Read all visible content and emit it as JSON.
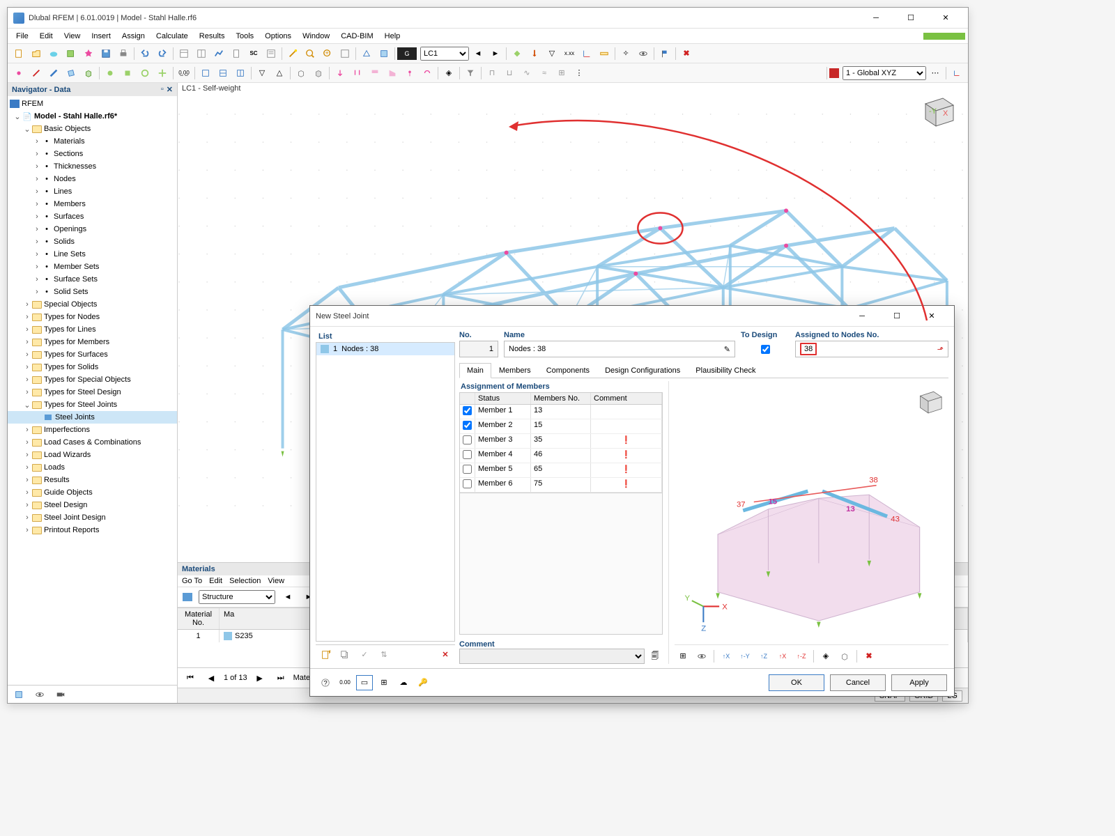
{
  "app": {
    "title": "Dlubal RFEM | 6.01.0019 | Model - Stahl Halle.rf6"
  },
  "menu": [
    "File",
    "Edit",
    "View",
    "Insert",
    "Assign",
    "Calculate",
    "Results",
    "Tools",
    "Options",
    "Window",
    "CAD-BIM",
    "Help"
  ],
  "toolbar2": {
    "lc_combo": "LC1",
    "coord_combo": "1 - Global XYZ"
  },
  "navigator": {
    "title": "Navigator - Data",
    "root": "RFEM",
    "model": "Model - Stahl Halle.rf6*",
    "basic_label": "Basic Objects",
    "basic": [
      "Materials",
      "Sections",
      "Thicknesses",
      "Nodes",
      "Lines",
      "Members",
      "Surfaces",
      "Openings",
      "Solids",
      "Line Sets",
      "Member Sets",
      "Surface Sets",
      "Solid Sets"
    ],
    "groups": [
      "Special Objects",
      "Types for Nodes",
      "Types for Lines",
      "Types for Members",
      "Types for Surfaces",
      "Types for Solids",
      "Types for Special Objects",
      "Types for Steel Design"
    ],
    "steel_joints_grp": "Types for Steel Joints",
    "steel_joints_item": "Steel Joints",
    "groups2": [
      "Imperfections",
      "Load Cases & Combinations",
      "Load Wizards",
      "Loads",
      "Results",
      "Guide Objects",
      "Steel Design",
      "Steel Joint Design",
      "Printout Reports"
    ]
  },
  "viewport": {
    "label": "LC1 - Self-weight"
  },
  "materials": {
    "title": "Materials",
    "menu": [
      "Go To",
      "Edit",
      "Selection",
      "View"
    ],
    "struct": "Structure",
    "head_no": "Material\nNo.",
    "head_mat": "Ma",
    "row_no": "1",
    "row_mat": "S235",
    "pager": "1 of 13",
    "pager_tail": "Materia"
  },
  "statusbar": {
    "snap": "SNAP",
    "grid": "GRID",
    "lg": "LG"
  },
  "dialog": {
    "title": "New Steel Joint",
    "list_label": "List",
    "list_item_no": "1",
    "list_item_txt": "Nodes : 38",
    "no_label": "No.",
    "no_value": "1",
    "name_label": "Name",
    "name_value": "Nodes : 38",
    "todesign_label": "To Design",
    "assigned_label": "Assigned to Nodes No.",
    "assigned_value": "38",
    "tabs": [
      "Main",
      "Members",
      "Components",
      "Design Configurations",
      "Plausibility Check"
    ],
    "assign_title": "Assignment of Members",
    "assign_cols": {
      "status": "Status",
      "members_no": "Members No.",
      "comment": "Comment"
    },
    "assign_rows": [
      {
        "checked": true,
        "name": "Member 1",
        "no": "13",
        "warn": false
      },
      {
        "checked": true,
        "name": "Member 2",
        "no": "15",
        "warn": false
      },
      {
        "checked": false,
        "name": "Member 3",
        "no": "35",
        "warn": true
      },
      {
        "checked": false,
        "name": "Member 4",
        "no": "46",
        "warn": true
      },
      {
        "checked": false,
        "name": "Member 5",
        "no": "65",
        "warn": true
      },
      {
        "checked": false,
        "name": "Member 6",
        "no": "75",
        "warn": true
      }
    ],
    "comment_label": "Comment",
    "preview_labels": {
      "n37": "37",
      "n38": "38",
      "n43": "43",
      "m15": "15",
      "m13": "13"
    },
    "buttons": {
      "ok": "OK",
      "cancel": "Cancel",
      "apply": "Apply"
    }
  }
}
